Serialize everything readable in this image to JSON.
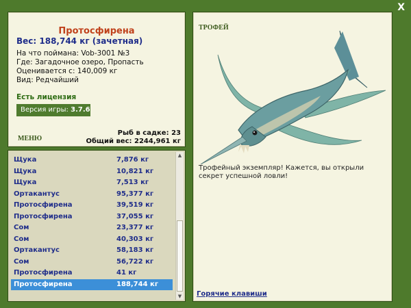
{
  "window": {
    "close_glyph": "X"
  },
  "fish": {
    "title": "Протосфирена",
    "weight_line": "Вес: 188,744 кг (зачетная)",
    "details": [
      "На что поймана: Vob-3001 №3",
      "Где: Загадочное озеро, Пропасть",
      "Оценивается с: 140,009 кг",
      "Вид: Редчайший"
    ]
  },
  "license": "Есть лицензия",
  "version": {
    "label": "Версия игры:",
    "value": "3.7.6"
  },
  "menu_label": "МЕНЮ",
  "stats": {
    "fish_in_cage": "Рыб в садке: 23",
    "total_weight": "Общий вес: 2244,961 кг"
  },
  "catch_list": [
    {
      "name": "Щука",
      "weight": "7,876 кг"
    },
    {
      "name": "Щука",
      "weight": "10,821 кг"
    },
    {
      "name": "Щука",
      "weight": "7,513 кг"
    },
    {
      "name": "Ортакантус",
      "weight": "95,377 кг"
    },
    {
      "name": "Протосфирена",
      "weight": "39,519 кг"
    },
    {
      "name": "Протосфирена",
      "weight": "37,055 кг"
    },
    {
      "name": "Сом",
      "weight": "23,377 кг"
    },
    {
      "name": "Сом",
      "weight": "40,303 кг"
    },
    {
      "name": "Ортакантус",
      "weight": "58,183 кг"
    },
    {
      "name": "Сом",
      "weight": "56,722 кг"
    },
    {
      "name": "Протосфирена",
      "weight": "41 кг"
    },
    {
      "name": "Протосфирена",
      "weight": "188,744 кг",
      "selected": true
    }
  ],
  "trophy": {
    "label": "ТРОФЕЙ",
    "description": "Трофейный экземпляр! Кажется, вы открыли секрет успешной ловли!",
    "hotkeys": "Горячие клавиши"
  },
  "colors": {
    "background": "#4e7a2c",
    "panel": "#f5f4e1",
    "title_accent": "#c0421c",
    "link_blue": "#1f2d8a",
    "selection": "#3c8fd8"
  }
}
